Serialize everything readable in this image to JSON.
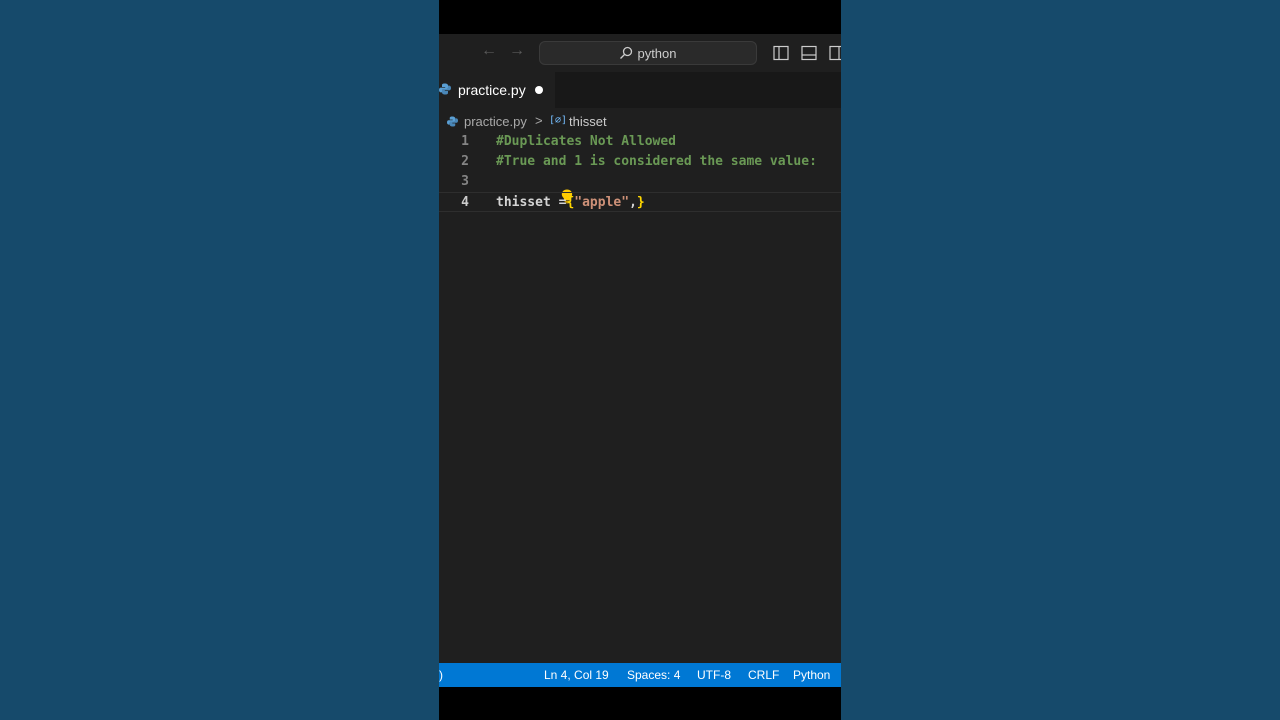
{
  "titlebar": {
    "search_text": "python"
  },
  "tab": {
    "label": "practice.py"
  },
  "breadcrumb": {
    "file": "practice.py",
    "separator": ">",
    "symbol_icon_text": "[∅]",
    "symbol": "thisset"
  },
  "editor": {
    "lines": [
      {
        "number": "1",
        "text": "#Duplicates Not Allowed"
      },
      {
        "number": "2",
        "text": "#True and 1 is considered the same value:"
      },
      {
        "number": "3",
        "text": ""
      },
      {
        "number": "4",
        "ident": "thisset =",
        "open": "{",
        "string": "\"apple\"",
        "comma": ",",
        "close": "}"
      }
    ]
  },
  "statusbar": {
    "left": ")",
    "position": "Ln 4, Col 19",
    "spaces": "Spaces: 4",
    "encoding": "UTF-8",
    "eol": "CRLF",
    "language": "Python"
  },
  "colors": {
    "accent": "#0078d4",
    "comment": "#6a9955",
    "string": "#ce9178",
    "bracket": "#ffd700",
    "background": "#164a6b"
  },
  "icons": {
    "back": "arrow-left-icon",
    "forward": "arrow-right-icon",
    "search": "search-icon",
    "python": "python-icon",
    "lightbulb": "lightbulb-icon"
  }
}
